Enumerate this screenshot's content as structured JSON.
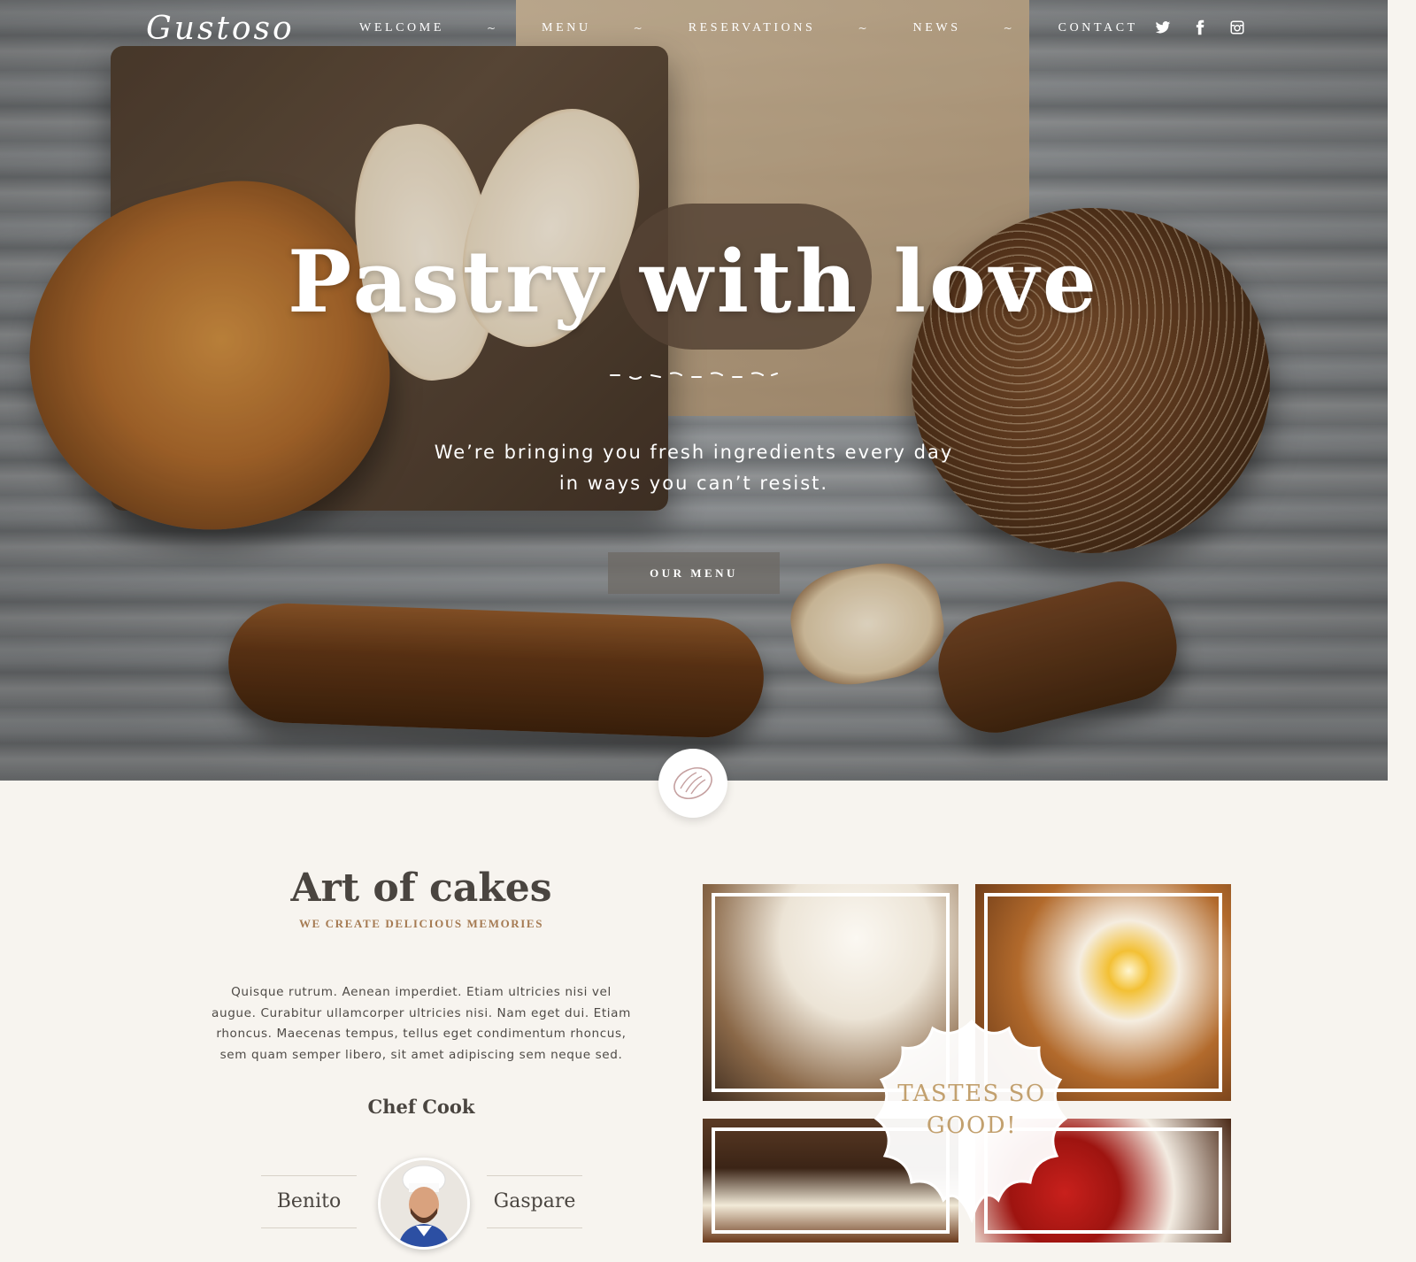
{
  "brand": {
    "logo": "Gustoso"
  },
  "nav": {
    "items": [
      "WELCOME",
      "MENU",
      "RESERVATIONS",
      "NEWS",
      "CONTACT"
    ],
    "separator": "~",
    "social": [
      {
        "icon": "twitter-icon",
        "glyph": "🐦"
      },
      {
        "icon": "facebook-icon",
        "glyph": "f"
      },
      {
        "icon": "instagram-icon",
        "glyph": "◘"
      }
    ]
  },
  "hero": {
    "headline": "Pastry with love",
    "subline": "We’re bringing you fresh ingredients every day in ways you can’t resist.",
    "cta_label": "OUR MENU"
  },
  "about": {
    "title": "Art of cakes",
    "subtitle": "WE CREATE DELICIOUS MEMORIES",
    "body": "Quisque rutrum. Aenean imperdiet. Etiam ultricies nisi vel augue. Curabitur ullamcorper ultricies nisi. Nam eget dui. Etiam rhoncus. Maecenas tempus, tellus eget condimentum rhoncus, sem quam semper libero, sit amet adipiscing sem neque sed.",
    "chef_title": "Chef Cook",
    "chef_first": "Benito",
    "chef_last": "Gaspare"
  },
  "gallery": {
    "badge": "TASTES SO GOOD!"
  },
  "colors": {
    "accent": "#a57a52",
    "badge_text": "#c2a06e",
    "heading": "#4a4540"
  }
}
